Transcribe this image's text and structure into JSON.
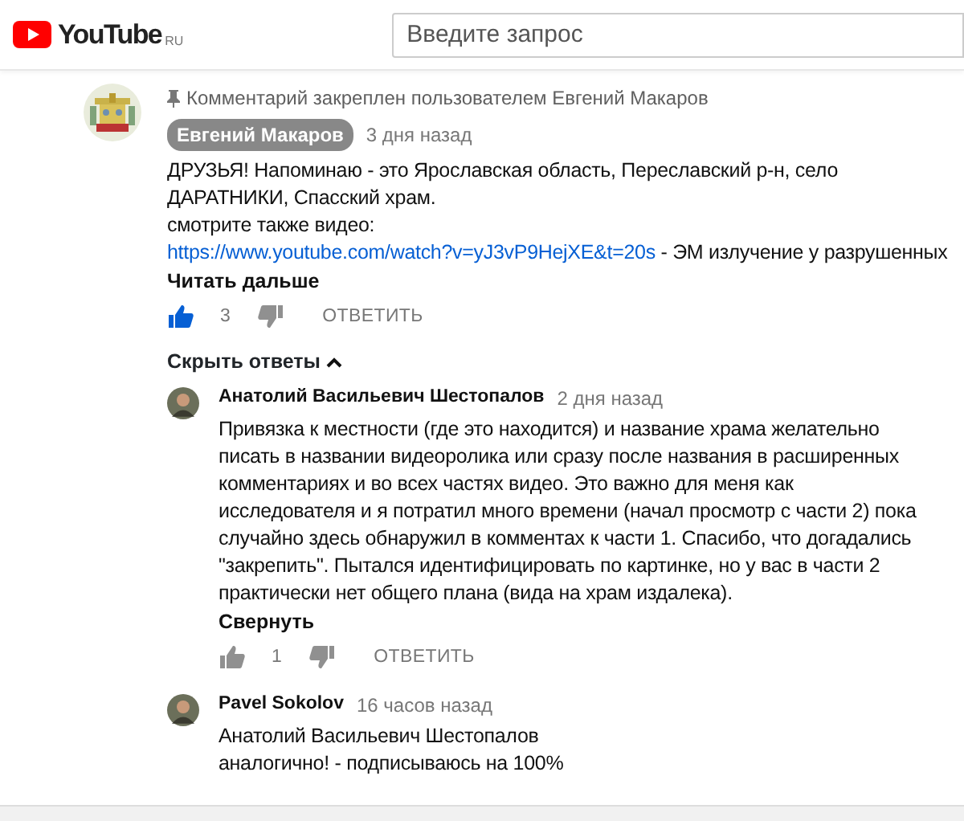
{
  "header": {
    "logo": "YouTube",
    "region": "RU",
    "search": {
      "placeholder": "Введите запрос"
    }
  },
  "pinned_comment": {
    "pinned_note": "Комментарий закреплен пользователем Евгений Макаров",
    "author": "Евгений Макаров",
    "author_is_owner": true,
    "time": "3 дня назад",
    "lines": [
      "ДРУЗЬЯ! Напоминаю - это Ярославская область, Переславский р-н, село",
      "ДАРАТНИКИ, Спасский храм.",
      "смотрите также видео:"
    ],
    "link": "https://www.youtube.com/watch?v=yJ3vP9HejXE&t=20s",
    "link_suffix": " - ЭМ излучение у разрушенных",
    "more": "Читать дальше",
    "likes": "3",
    "liked": true,
    "reply": "ОТВЕТИТЬ"
  },
  "replies_toggle": {
    "label": "Скрыть ответы",
    "expanded": true
  },
  "replies": [
    {
      "author": "Анатолий Васильевич Шестопалов",
      "time": "2 дня назад",
      "lines": [
        "Привязка к местности (где это находится) и название храма желательно",
        "писать в названии видеоролика или сразу после названия в расширенных",
        "комментариях и во всех частях видео. Это важно для меня как",
        "исследователя и я потратил много времени (начал просмотр с части 2) пока",
        "случайно здесь обнаружил в комментах к части 1. Спасибо, что догадались",
        "\"закрепить\". Пытался идентифицировать по картинке, но у вас в части 2",
        "практически нет общего плана (вида на храм издалека)."
      ],
      "collapse": "Свернуть",
      "likes": "1",
      "liked": false,
      "reply": "ОТВЕТИТЬ"
    },
    {
      "author": "Pavel Sokolov",
      "time": "16 часов назад",
      "lines": [
        "Анатолий Васильевич Шестопалов",
        "аналогично! - подписываюсь на 100%"
      ]
    }
  ]
}
